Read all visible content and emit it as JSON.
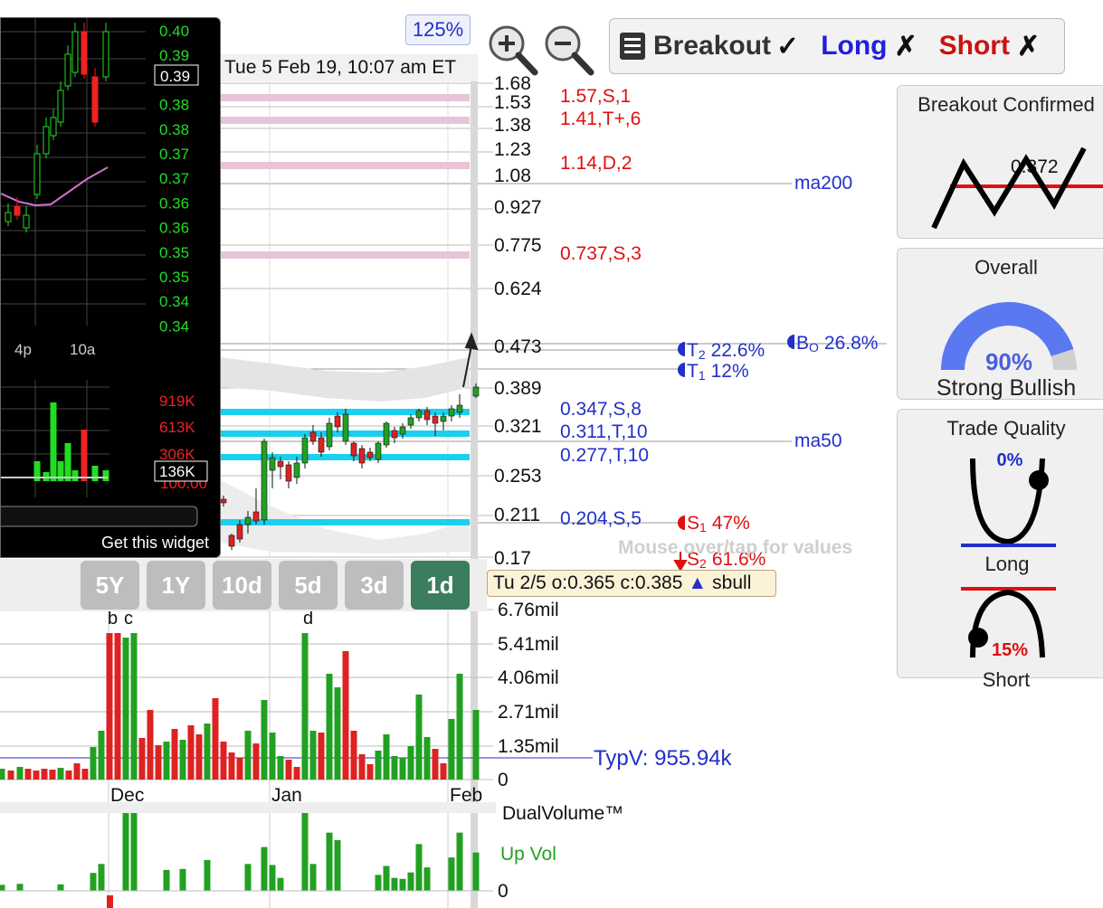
{
  "zoom": {
    "percent": "125%"
  },
  "signals": {
    "breakout": {
      "label": "Breakout",
      "mark": "✓"
    },
    "long": {
      "label": "Long",
      "mark": "✗"
    },
    "short": {
      "label": "Short",
      "mark": "✗"
    }
  },
  "header": {
    "date": "Tue 5 Feb 19, 10:07 am ET"
  },
  "widget": {
    "price_labels": [
      "0.40",
      "0.39",
      "0.39",
      "0.38",
      "0.38",
      "0.37",
      "0.37",
      "0.36",
      "0.36",
      "0.35",
      "0.35",
      "0.34",
      "0.34"
    ],
    "current_price": "0.39",
    "time_labels": [
      "4p",
      "10a"
    ],
    "vol_labels": [
      "919K",
      "613K",
      "306K",
      "136K"
    ],
    "vol_overlap": "100.00",
    "footer": "Get this widget"
  },
  "price_axis": [
    "1.68",
    "1.53",
    "1.38",
    "1.23",
    "1.08",
    "0.927",
    "0.775",
    "0.624",
    "0.473",
    "0.389",
    "0.321",
    "0.253",
    "0.211",
    "0.17"
  ],
  "levels": {
    "resistance": [
      "1.57,S,1",
      "1.41,T+,6",
      "1.14,D,2",
      "0.737,S,3"
    ],
    "support": [
      "0.347,S,8",
      "0.311,T,10",
      "0.277,T,10",
      "0.204,S,5"
    ],
    "ma200": "ma200",
    "ma50": "ma50",
    "t2": {
      "label": "T",
      "sub": "2",
      "pct": "22.6%"
    },
    "t1": {
      "label": "T",
      "sub": "1",
      "pct": "12%"
    },
    "bo": {
      "label": "B",
      "sub": "O",
      "pct": "26.8%"
    },
    "s1": {
      "label": "S",
      "sub": "1",
      "pct": "47%"
    },
    "s2": {
      "label": "S",
      "sub": "2",
      "pct": "61.6%"
    }
  },
  "hint": "Mouse over/tap for values",
  "tooltip": {
    "text": "Tu 2/5 o:0.365 c:0.385",
    "arrow": "▲",
    "tag": "sbull"
  },
  "timeframes": [
    "5Y",
    "1Y",
    "10d",
    "5d",
    "3d",
    "1d"
  ],
  "active_timeframe": "1d",
  "volume_axis": [
    "6.76mil",
    "5.41mil",
    "4.06mil",
    "2.71mil",
    "1.35mil",
    "0"
  ],
  "typv": "TypV: 955.94k",
  "months": [
    "Dec",
    "Jan",
    "Feb"
  ],
  "event_markers": [
    "b",
    "c",
    "d"
  ],
  "dual_volume": {
    "title": "DualVolume™",
    "up": "Up Vol",
    "zero": "0"
  },
  "panels": {
    "breakout": {
      "title": "Breakout Confirmed",
      "value": "0.372"
    },
    "overall": {
      "title": "Overall",
      "percent": "90%",
      "label": "Strong Bullish",
      "fraction": 0.9
    },
    "trade_quality": {
      "title": "Trade Quality",
      "long_pct": "0%",
      "long_label": "Long",
      "short_pct": "15%",
      "short_label": "Short"
    }
  },
  "colors": {
    "up": "#22a022",
    "down": "#dd2222",
    "support": "#1ad0ee",
    "resistance": "#e8c4d8",
    "blue": "#2230c8",
    "red": "#dd1111"
  }
}
